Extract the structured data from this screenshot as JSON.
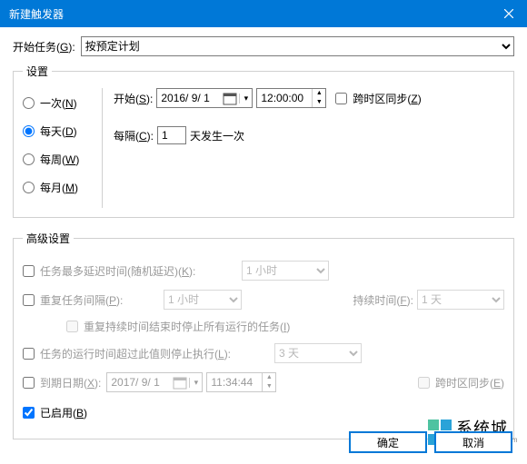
{
  "window": {
    "title": "新建触发器"
  },
  "start": {
    "label_pre": "开始任务(",
    "label_key": "G",
    "label_post": "):",
    "selected": "按预定计划"
  },
  "settings": {
    "legend": "设置",
    "radios": {
      "once": {
        "pre": "一次(",
        "key": "N",
        "post": ")"
      },
      "daily": {
        "pre": "每天(",
        "key": "D",
        "post": ")"
      },
      "weekly": {
        "pre": "每周(",
        "key": "W",
        "post": ")"
      },
      "monthly": {
        "pre": "每月(",
        "key": "M",
        "post": ")"
      }
    },
    "begin": {
      "pre": "开始(",
      "key": "S",
      "post": "):"
    },
    "date": "2016/ 9/ 1",
    "time": "12:00:00",
    "tz": {
      "pre": "跨时区同步(",
      "key": "Z",
      "post": ")"
    },
    "interval": {
      "pre": "每隔(",
      "key": "C",
      "post": "):",
      "value": "1",
      "suffix": "天发生一次"
    }
  },
  "advanced": {
    "legend": "高级设置",
    "delay": {
      "pre": "任务最多延迟时间(随机延迟)(",
      "key": "K",
      "post": "):",
      "value": "1 小时"
    },
    "repeat": {
      "pre": "重复任务间隔(",
      "key": "P",
      "post": "):",
      "value": "1 小时",
      "duration_pre": "持续时间(",
      "duration_key": "F",
      "duration_post": "):",
      "duration_value": "1 天"
    },
    "stop_all": {
      "pre": "重复持续时间结束时停止所有运行的任务(",
      "key": "I",
      "post": ")"
    },
    "stop_after": {
      "pre": "任务的运行时间超过此值则停止执行(",
      "key": "L",
      "post": "):",
      "value": "3 天"
    },
    "expire": {
      "pre": "到期日期(",
      "key": "X",
      "post": "):",
      "date": "2017/ 9/ 1",
      "time": "11:34:44",
      "tz_pre": "跨时区同步(",
      "tz_key": "E",
      "tz_post": ")"
    },
    "enabled": {
      "pre": "已启用(",
      "key": "B",
      "post": ")"
    }
  },
  "buttons": {
    "ok": "确定",
    "cancel": "取消"
  },
  "watermark": {
    "cn": "系统城",
    "en": "xitongcheng.com"
  }
}
